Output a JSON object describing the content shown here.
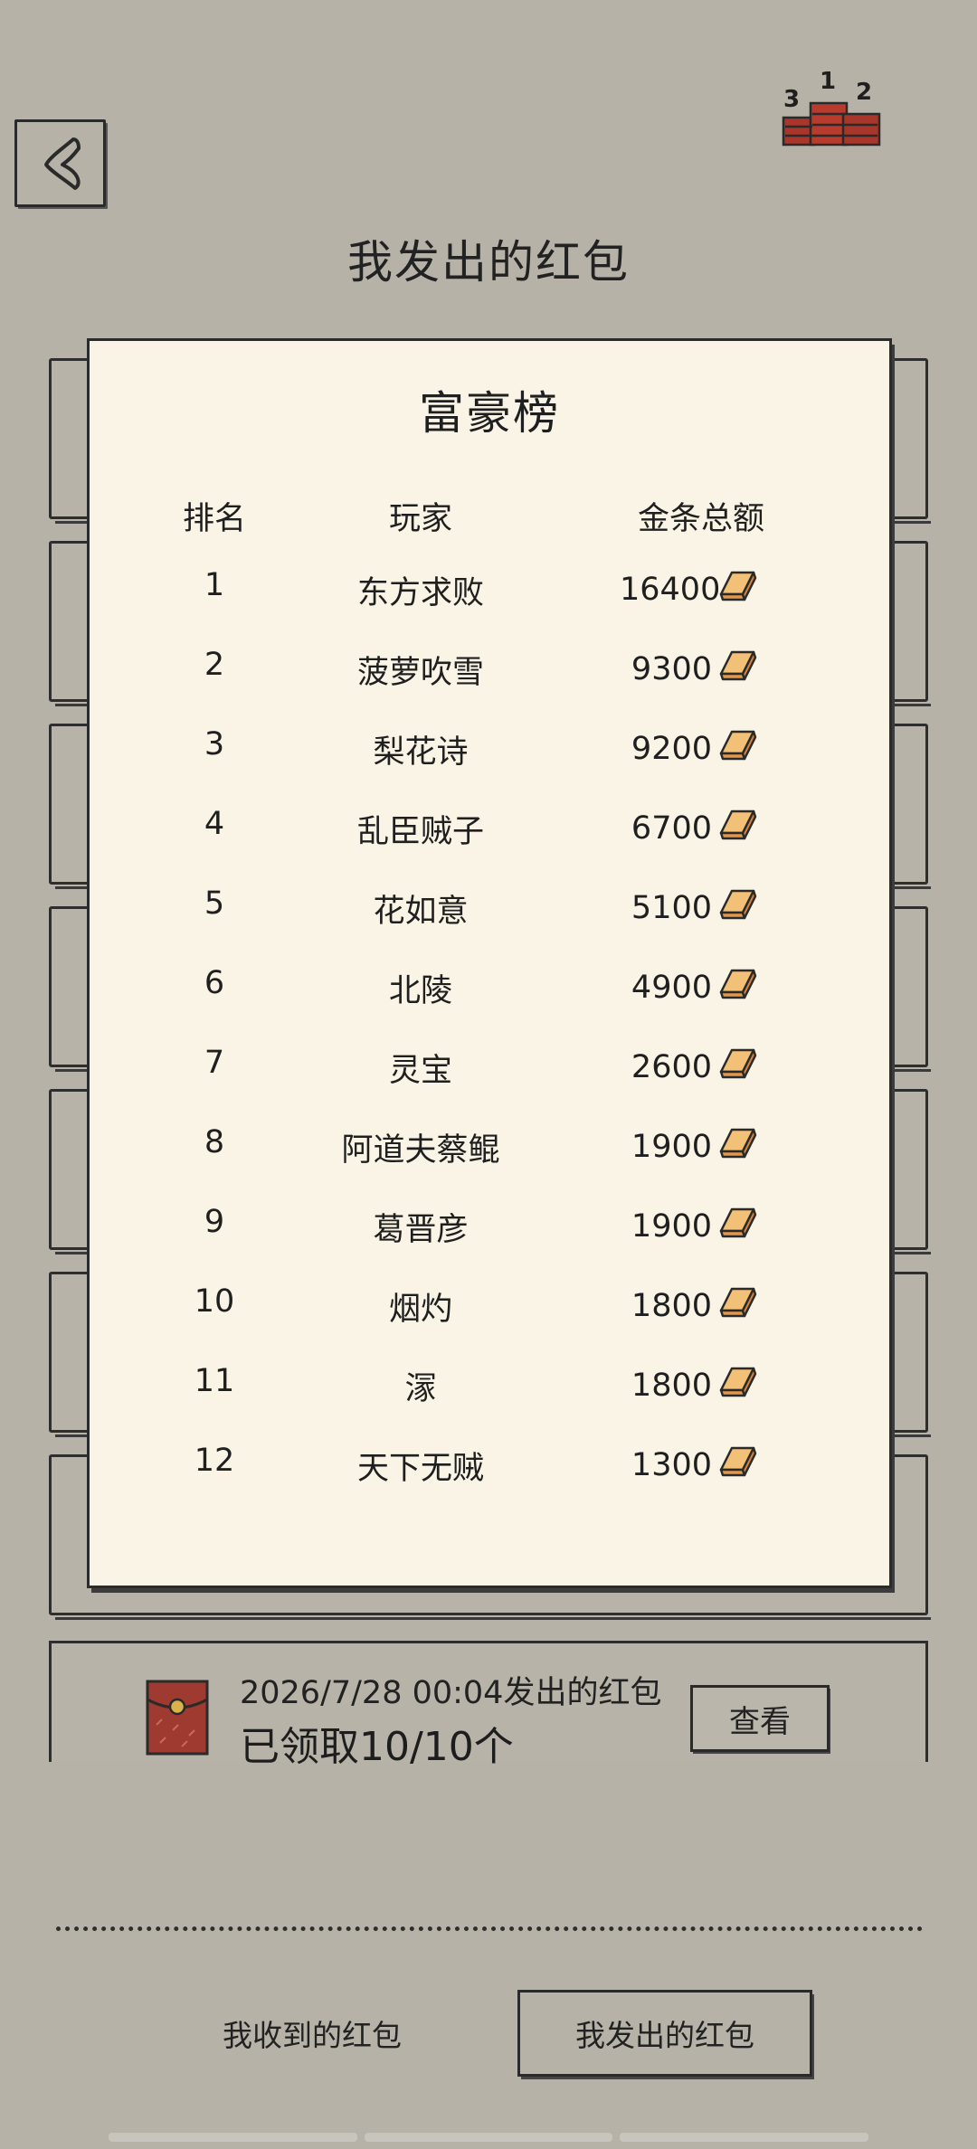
{
  "header": {
    "title": "我发出的红包",
    "rank_icon_numbers": [
      "3",
      "1",
      "2"
    ]
  },
  "board": {
    "title": "富豪榜",
    "columns": [
      "排名",
      "玩家",
      "金条总额"
    ],
    "rows": [
      {
        "rank": "1",
        "player": "东方求败",
        "amount": "16400"
      },
      {
        "rank": "2",
        "player": "菠萝吹雪",
        "amount": "9300"
      },
      {
        "rank": "3",
        "player": "梨花诗",
        "amount": "9200"
      },
      {
        "rank": "4",
        "player": "乱臣贼子",
        "amount": "6700"
      },
      {
        "rank": "5",
        "player": "花如意",
        "amount": "5100"
      },
      {
        "rank": "6",
        "player": "北陵",
        "amount": "4900"
      },
      {
        "rank": "7",
        "player": "灵宝",
        "amount": "2600"
      },
      {
        "rank": "8",
        "player": "阿道夫蔡鲲",
        "amount": "1900"
      },
      {
        "rank": "9",
        "player": "葛晋彦",
        "amount": "1900"
      },
      {
        "rank": "10",
        "player": "烟灼",
        "amount": "1800"
      },
      {
        "rank": "11",
        "player": "溕",
        "amount": "1800"
      },
      {
        "rank": "12",
        "player": "天下无贼",
        "amount": "1300"
      }
    ]
  },
  "record": {
    "time_text": "2026/7/28 00:04发出的红包",
    "count_text": "已领取10/10个",
    "view_label": "查看"
  },
  "tabs": {
    "received": "我收到的红包",
    "sent": "我发出的红包"
  },
  "colors": {
    "background": "#b6b2a7",
    "paper": "#f9f4e5",
    "gold": "#e8a24a",
    "envelope": "#9e3a2f"
  }
}
